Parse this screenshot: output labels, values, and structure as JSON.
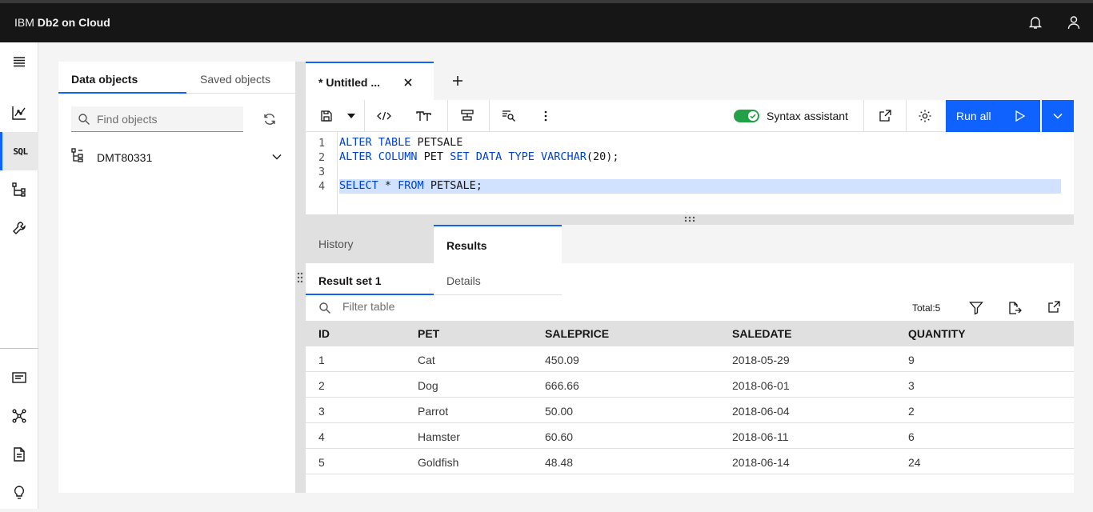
{
  "app": {
    "brand_prefix": "IBM ",
    "brand_name": "Db2 on Cloud"
  },
  "topbar": {
    "icons": [
      "notification-icon",
      "user-icon"
    ]
  },
  "sidenav": {
    "items": [
      {
        "icon": "menu-icon"
      },
      {
        "icon": "chart-icon"
      },
      {
        "icon": "sql-icon",
        "label": "SQL",
        "active": true
      },
      {
        "icon": "hierarchy-icon"
      },
      {
        "icon": "wrench-icon"
      },
      {
        "icon": "catalog-icon"
      },
      {
        "icon": "network-icon"
      },
      {
        "icon": "document-icon"
      },
      {
        "icon": "lightbulb-icon"
      }
    ]
  },
  "left_panel": {
    "tabs": [
      "Data objects",
      "Saved objects"
    ],
    "active_tab": "Data objects",
    "search_placeholder": "Find objects",
    "schema": "DMT80331"
  },
  "editor": {
    "tab_title": "* Untitled ...",
    "syntax_assistant_label": "Syntax assistant",
    "syntax_assistant_on": true,
    "run_label": "Run all",
    "line_numbers": [
      "1",
      "2",
      "3",
      "4"
    ]
  },
  "results": {
    "tabs": [
      "History",
      "Results"
    ],
    "active_tab": "Results",
    "subtabs": [
      "Result set 1",
      "Details"
    ],
    "filter_placeholder": "Filter table",
    "total": "Total:5",
    "columns": [
      "ID",
      "PET",
      "SALEPRICE",
      "SALEDATE",
      "QUANTITY"
    ],
    "rows": [
      [
        "1",
        "Cat",
        "450.09",
        "2018-05-29",
        "9"
      ],
      [
        "2",
        "Dog",
        "666.66",
        "2018-06-01",
        "3"
      ],
      [
        "3",
        "Parrot",
        "50.00",
        "2018-06-04",
        "2"
      ],
      [
        "4",
        "Hamster",
        "60.60",
        "2018-06-11",
        "6"
      ],
      [
        "5",
        "Goldfish",
        "48.48",
        "2018-06-14",
        "24"
      ]
    ]
  },
  "colors": {
    "accent": "#0f62fe",
    "toggle_on": "#24a148",
    "keyword": "#0043ce",
    "selection": "#d0e2ff"
  }
}
